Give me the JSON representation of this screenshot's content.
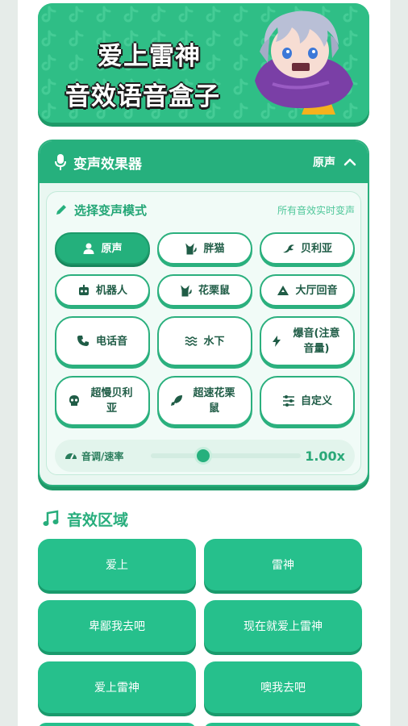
{
  "banner": {
    "title_line1": "爱上雷神",
    "title_line2": "音效语音盒子",
    "mascot": "cartoon-character-image"
  },
  "voice_panel": {
    "title": "变声效果器",
    "current_mode": "原声",
    "icons": {
      "header": "microphone-icon",
      "collapse": "chevron-up-icon"
    },
    "mode_section_title": "选择变声模式",
    "mode_hint": "所有音效实时变声",
    "modes": [
      {
        "label": "原声",
        "icon": "person-icon",
        "active": true
      },
      {
        "label": "胖猫",
        "icon": "cat-icon",
        "active": false
      },
      {
        "label": "贝利亚",
        "icon": "dragon-icon",
        "active": false
      },
      {
        "label": "机器人",
        "icon": "robot-icon",
        "active": false
      },
      {
        "label": "花栗鼠",
        "icon": "cat-icon",
        "active": false
      },
      {
        "label": "大厅回音",
        "icon": "mountain-icon",
        "active": false
      },
      {
        "label": "电话音",
        "icon": "phone-icon",
        "active": false
      },
      {
        "label": "水下",
        "icon": "water-icon",
        "active": false
      },
      {
        "label": "爆音(注意音量)",
        "icon": "bolt-icon",
        "active": false
      },
      {
        "label": "超慢贝利亚",
        "icon": "skull-icon",
        "active": false
      },
      {
        "label": "超速花栗鼠",
        "icon": "rocket-icon",
        "active": false
      },
      {
        "label": "自定义",
        "icon": "sliders-icon",
        "active": false
      }
    ],
    "pitch": {
      "label": "音调/速率",
      "value": "1.00x",
      "slider_fraction": 0.35
    }
  },
  "sound_effects": {
    "title": "音效区域",
    "icon": "music-note-icon",
    "buttons": [
      "爱上",
      "雷神",
      "卑鄙我去吧",
      "现在就爱上雷神",
      "爱上雷神",
      "噢我去吧"
    ]
  },
  "colors": {
    "accent": "#26b07d",
    "accent_dark": "#1e9a68",
    "button_green": "#26c08c",
    "background": "#e6ece9"
  }
}
